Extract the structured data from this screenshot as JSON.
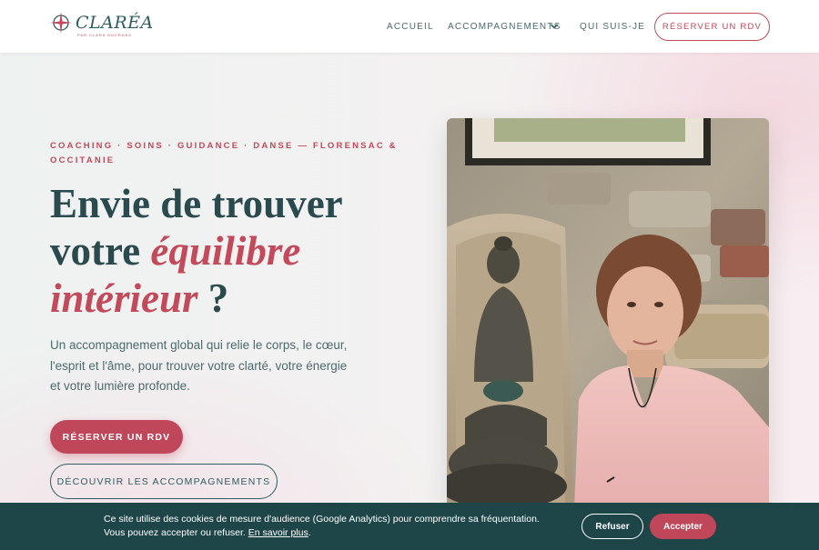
{
  "header": {
    "logo_text": "CLARÉA",
    "logo_sub": "PAR CLARA DUCRAND",
    "nav": {
      "accueil": "ACCUEIL",
      "accompagnements": "ACCOMPAGNEMENTS",
      "qui": "QUI SUIS-JE"
    },
    "cta": "RÉSERVER UN RDV"
  },
  "hero": {
    "eyebrow": "COACHING · SOINS · GUIDANCE · DANSE — FLORENSAC & OCCITANIE",
    "headline_line1": "Envie de trouver",
    "headline_line2_prefix": "votre ",
    "headline_accent1": "équilibre",
    "headline_accent2": "intérieur",
    "headline_suffix": " ?",
    "lead": "Un accompagnement global qui relie le corps, le cœur, l'esprit et l'âme, pour trouver votre clarté, votre énergie et votre lumière profonde.",
    "primary_cta": "RÉSERVER UN RDV",
    "secondary_cta": "DÉCOUVRIR LES ACCOMPAGNEMENTS"
  },
  "cookie": {
    "text": "Ce site utilise des cookies de mesure d'audience (Google Analytics) pour comprendre sa fréquentation. Vous pouvez accepter ou refuser.",
    "link": "En savoir plus",
    "link_suffix": ".",
    "refuse": "Refuser",
    "accept": "Accepter"
  },
  "colors": {
    "accent": "#c0475a",
    "teal": "#2f5d62",
    "cookie_bg": "#1e4548"
  },
  "icons": {
    "logo": "compass-star-icon",
    "nav_dropdown": "chevron-down-icon"
  }
}
